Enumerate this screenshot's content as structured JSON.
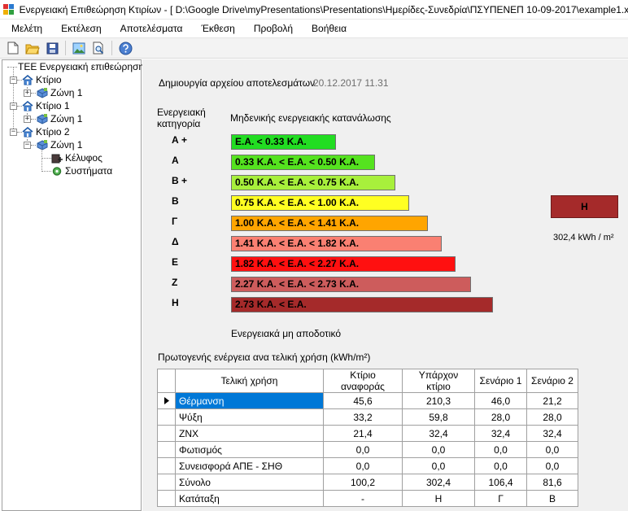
{
  "window": {
    "title": "Ενεργειακή Επιθεώρηση Κτιρίων - [ D:\\Google Drive\\myPresentations\\Presentations\\Ημερίδες-Συνεδρία\\ΠΣΥΠΕΝΕΠ 10-09-2017\\example1.xml ]"
  },
  "menu": [
    "Μελέτη",
    "Εκτέλεση",
    "Αποτελέσματα",
    "Έκθεση",
    "Προβολή",
    "Βοήθεια"
  ],
  "toolbar": {
    "icons": [
      "new-file-icon",
      "open-folder-icon",
      "save-icon",
      "image-icon",
      "print-preview-icon",
      "help-icon"
    ]
  },
  "tree": {
    "root": "ΤΕΕ Ενεργειακή επιθεώρηση",
    "buildings": [
      {
        "label": "Κτίριο",
        "zones": [
          "Ζώνη 1"
        ]
      },
      {
        "label": "Κτίριο 1",
        "zones": [
          "Ζώνη 1"
        ]
      },
      {
        "label": "Κτίριο 2",
        "zones": [
          "Ζώνη 1"
        ],
        "children": [
          "Κέλυφος",
          "Συστήματα"
        ]
      }
    ]
  },
  "results": {
    "created_label": "Δημιουργία αρχείου αποτελεσμάτων",
    "created_value": "20.12.2017 11.31",
    "category_header_line1": "Ενεργειακή",
    "category_header_line2": "κατηγορία",
    "zero_label": "Μηδενικής ενεργειακής κατανάλωσης",
    "bottom_label": "Ενεργειακά μη αποδοτικό",
    "ratings": [
      {
        "letter": "Α +",
        "range": "Ε.Α. < 0.33 Κ.Α.",
        "color": "#22dd22"
      },
      {
        "letter": "Α",
        "range": "0.33 Κ.Α. <  Ε.Α. < 0.50 Κ.Α.",
        "color": "#55e31f"
      },
      {
        "letter": "Β +",
        "range": "0.50 Κ.Α. <  Ε.Α. < 0.75 Κ.Α.",
        "color": "#a8f03c"
      },
      {
        "letter": "Β",
        "range": "0.75 Κ.Α. <  Ε.Α. < 1.00 Κ.Α.",
        "color": "#ffff22"
      },
      {
        "letter": "Γ",
        "range": "1.00 Κ.Α. <  Ε.Α. < 1.41 Κ.Α.",
        "color": "#ffa500"
      },
      {
        "letter": "Δ",
        "range": "1.41 Κ.Α. <  Ε.Α. < 1.82 Κ.Α.",
        "color": "#fa8072"
      },
      {
        "letter": "Ε",
        "range": "1.82 Κ.Α. <  Ε.Α. < 2.27 Κ.Α.",
        "color": "#ff1010"
      },
      {
        "letter": "Ζ",
        "range": "2.27 Κ.Α. <  Ε.Α. < 2.73 Κ.Α.",
        "color": "#cd5c5c"
      },
      {
        "letter": "Η",
        "range": "2.73 Κ.Α. <  Ε.Α.",
        "color": "#a52a2a"
      }
    ],
    "current_class": "Η",
    "current_class_color": "#a52a2a",
    "current_value": "302,4 kWh / m²"
  },
  "table": {
    "title": "Πρωτογενής ενέργεια ανα τελική χρήση (kWh/m²)",
    "headers": [
      "Τελική χρήση",
      "Κτίριο αναφοράς",
      "Υπάρχον κτίριο",
      "Σενάριο 1",
      "Σενάριο 2"
    ],
    "rows": [
      [
        "Θέρμανση",
        "45,6",
        "210,3",
        "46,0",
        "21,2"
      ],
      [
        "Ψύξη",
        "33,2",
        "59,8",
        "28,0",
        "28,0"
      ],
      [
        "ΖΝΧ",
        "21,4",
        "32,4",
        "32,4",
        "32,4"
      ],
      [
        "Φωτισμός",
        "0,0",
        "0,0",
        "0,0",
        "0,0"
      ],
      [
        "Συνεισφορά ΑΠΕ - ΣΗΘ",
        "0,0",
        "0,0",
        "0,0",
        "0,0"
      ],
      [
        "Σύνολο",
        "100,2",
        "302,4",
        "106,4",
        "81,6"
      ],
      [
        "Κατάταξη",
        "-",
        "Η",
        "Γ",
        "Β"
      ]
    ],
    "selected_row": 0
  }
}
